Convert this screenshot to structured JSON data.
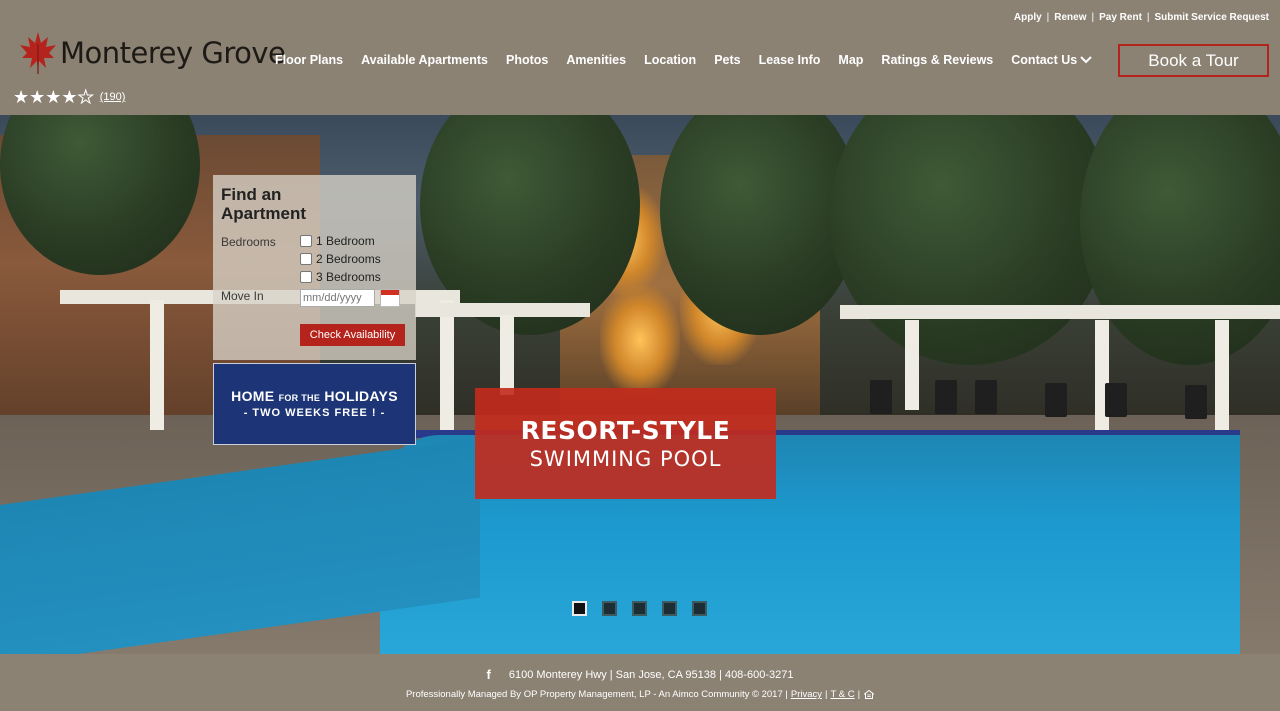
{
  "utility_links": [
    "Apply",
    "Renew",
    "Pay Rent",
    "Submit Service Request"
  ],
  "logo": {
    "text": "Monterey Grove",
    "icon": "maple-leaf-icon",
    "color": "#b5241c"
  },
  "nav": [
    {
      "label": "Floor Plans"
    },
    {
      "label": "Available Apartments"
    },
    {
      "label": "Photos"
    },
    {
      "label": "Amenities"
    },
    {
      "label": "Location"
    },
    {
      "label": "Pets"
    },
    {
      "label": "Lease Info"
    },
    {
      "label": "Map"
    },
    {
      "label": "Ratings & Reviews"
    },
    {
      "label": "Contact Us",
      "has_dropdown": true
    }
  ],
  "book_tour": "Book a Tour",
  "rating": {
    "stars": 4,
    "max": 5,
    "count": "(190)"
  },
  "finder": {
    "title_line1": "Find an",
    "title_line2": "Apartment",
    "bedrooms_label": "Bedrooms",
    "options": [
      "1 Bedroom",
      "2 Bedrooms",
      "3 Bedrooms"
    ],
    "move_in_label": "Move In",
    "date_placeholder": "mm/dd/yyyy",
    "check_button": "Check Availability"
  },
  "holiday": {
    "home": "HOME",
    "for_the": "FOR THE",
    "holidays": "HOLIDAYS",
    "line2": "- TWO WEEKS FREE ! -"
  },
  "promo": {
    "line1": "RESORT-STYLE",
    "line2": "SWIMMING POOL"
  },
  "slides": {
    "count": 5,
    "active": 1
  },
  "footer": {
    "address": "6100 Monterey Hwy | San Jose, CA 95138 | 408-600-3271",
    "managed": "Professionally Managed By OP Property Management, LP - An Aimco Community © 2017 |",
    "privacy": "Privacy",
    "terms": "T & C"
  },
  "colors": {
    "header_bg": "#8b8274",
    "accent": "#b5241c",
    "holiday_bg": "#1d3576"
  }
}
